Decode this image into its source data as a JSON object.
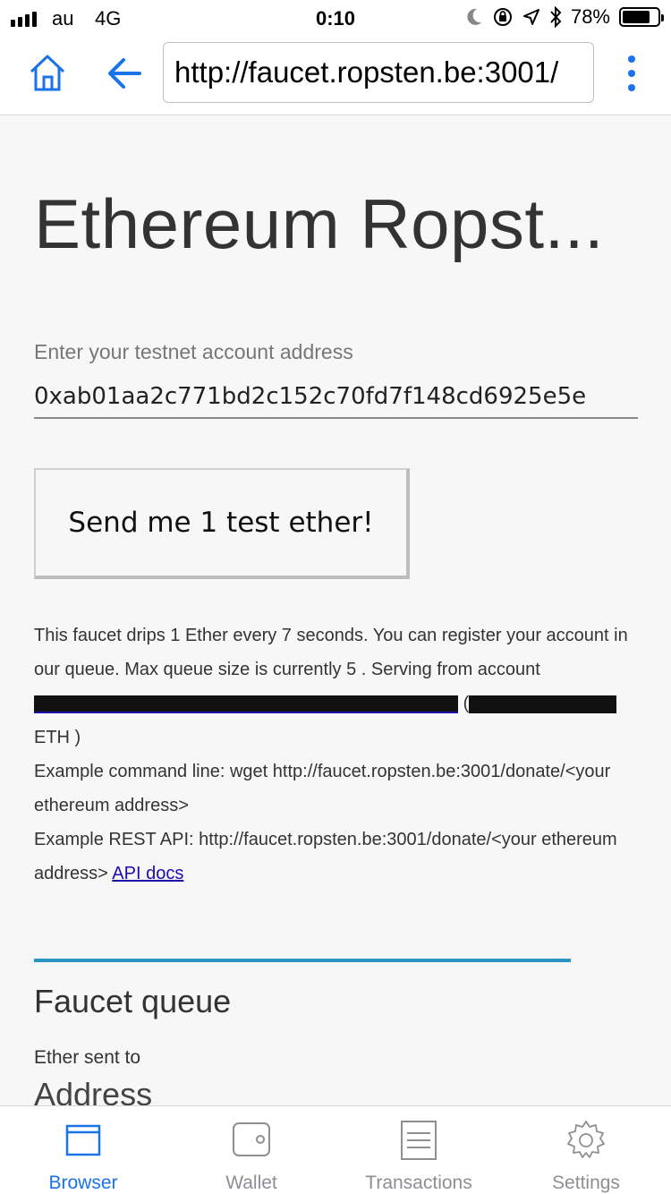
{
  "status_bar": {
    "carrier": "au",
    "network": "4G",
    "time": "0:10",
    "battery_percent": "78%",
    "battery_level": 0.78
  },
  "browser": {
    "url": "http://faucet.ropsten.be:3001/"
  },
  "page": {
    "title": "Ethereum Ropst...",
    "address_label": "Enter your testnet account address",
    "address_value": "0xab01aa2c771bd2c152c70fd7f148cd6925e5e",
    "send_button": "Send me 1 test ether!",
    "info": {
      "drip_text": "This faucet drips 1 Ether every 7 seconds. You can register your account in our queue. Max queue size is currently 5",
      "serving_text": ". Serving from account",
      "paren_open": "(",
      "eth_unit": "ETH )",
      "example_cmd": "Example command line: wget http://faucet.ropsten.be:3001/donate/<your ethereum address>",
      "example_api": "Example REST API: http://faucet.ropsten.be:3001/donate/<your ethereum address>",
      "api_docs_link": "API docs"
    },
    "queue_title": "Faucet queue",
    "queue_label": "Ether sent to",
    "queue_column": "Address"
  },
  "tabs": [
    {
      "label": "Browser",
      "icon": "browser-icon",
      "active": true
    },
    {
      "label": "Wallet",
      "icon": "wallet-icon",
      "active": false
    },
    {
      "label": "Transactions",
      "icon": "transactions-icon",
      "active": false
    },
    {
      "label": "Settings",
      "icon": "settings-icon",
      "active": false
    }
  ],
  "colors": {
    "accent": "#1a73e8",
    "divider": "#2a94c4",
    "link": "#1a0dab"
  }
}
